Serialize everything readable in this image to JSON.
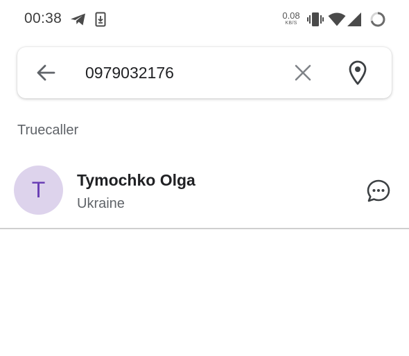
{
  "status_bar": {
    "time": "00:38",
    "net_speed_value": "0.08",
    "net_speed_unit": "KB/S",
    "icons": [
      "telegram-icon",
      "download-icon",
      "vibrate-icon",
      "wifi-icon",
      "signal-icon",
      "battery-ring-icon"
    ]
  },
  "search": {
    "query": "0979032176",
    "back_icon": "arrow-left-icon",
    "clear_icon": "close-icon",
    "location_icon": "location-pin-icon"
  },
  "section": {
    "title": "Truecaller"
  },
  "results": [
    {
      "avatar_letter": "T",
      "name": "Tymochko Olga",
      "country": "Ukraine",
      "action_icon": "message-icon"
    }
  ],
  "colors": {
    "avatar_bg": "#ddd3ec",
    "avatar_text": "#6a3fb5",
    "icon_gray": "#5f6368"
  }
}
